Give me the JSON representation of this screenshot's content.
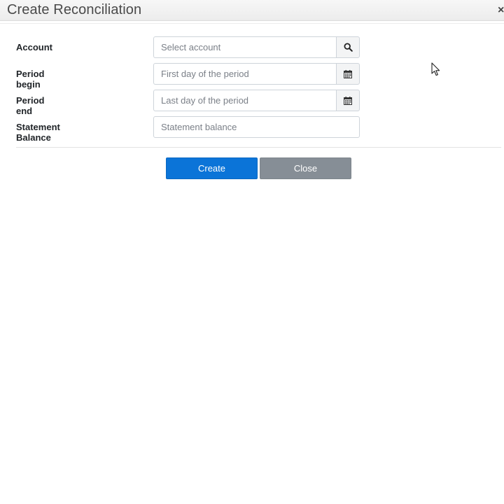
{
  "dialog": {
    "title": "Create Reconciliation",
    "close_glyph": "×"
  },
  "form": {
    "account": {
      "label": "Account",
      "placeholder": "Select account",
      "value": "",
      "addon_icon": "search-icon"
    },
    "period_begin": {
      "label": "Period begin",
      "placeholder": "First day of the period",
      "value": "",
      "addon_icon": "calendar-icon"
    },
    "period_end": {
      "label": "Period end",
      "placeholder": "Last day of the period",
      "value": "",
      "addon_icon": "calendar-icon"
    },
    "statement_balance": {
      "label": "Statement Balance",
      "placeholder": "Statement balance",
      "value": ""
    }
  },
  "actions": {
    "create_label": "Create",
    "close_label": "Close"
  },
  "colors": {
    "primary": "#0b74d8",
    "secondary": "#868e96"
  }
}
